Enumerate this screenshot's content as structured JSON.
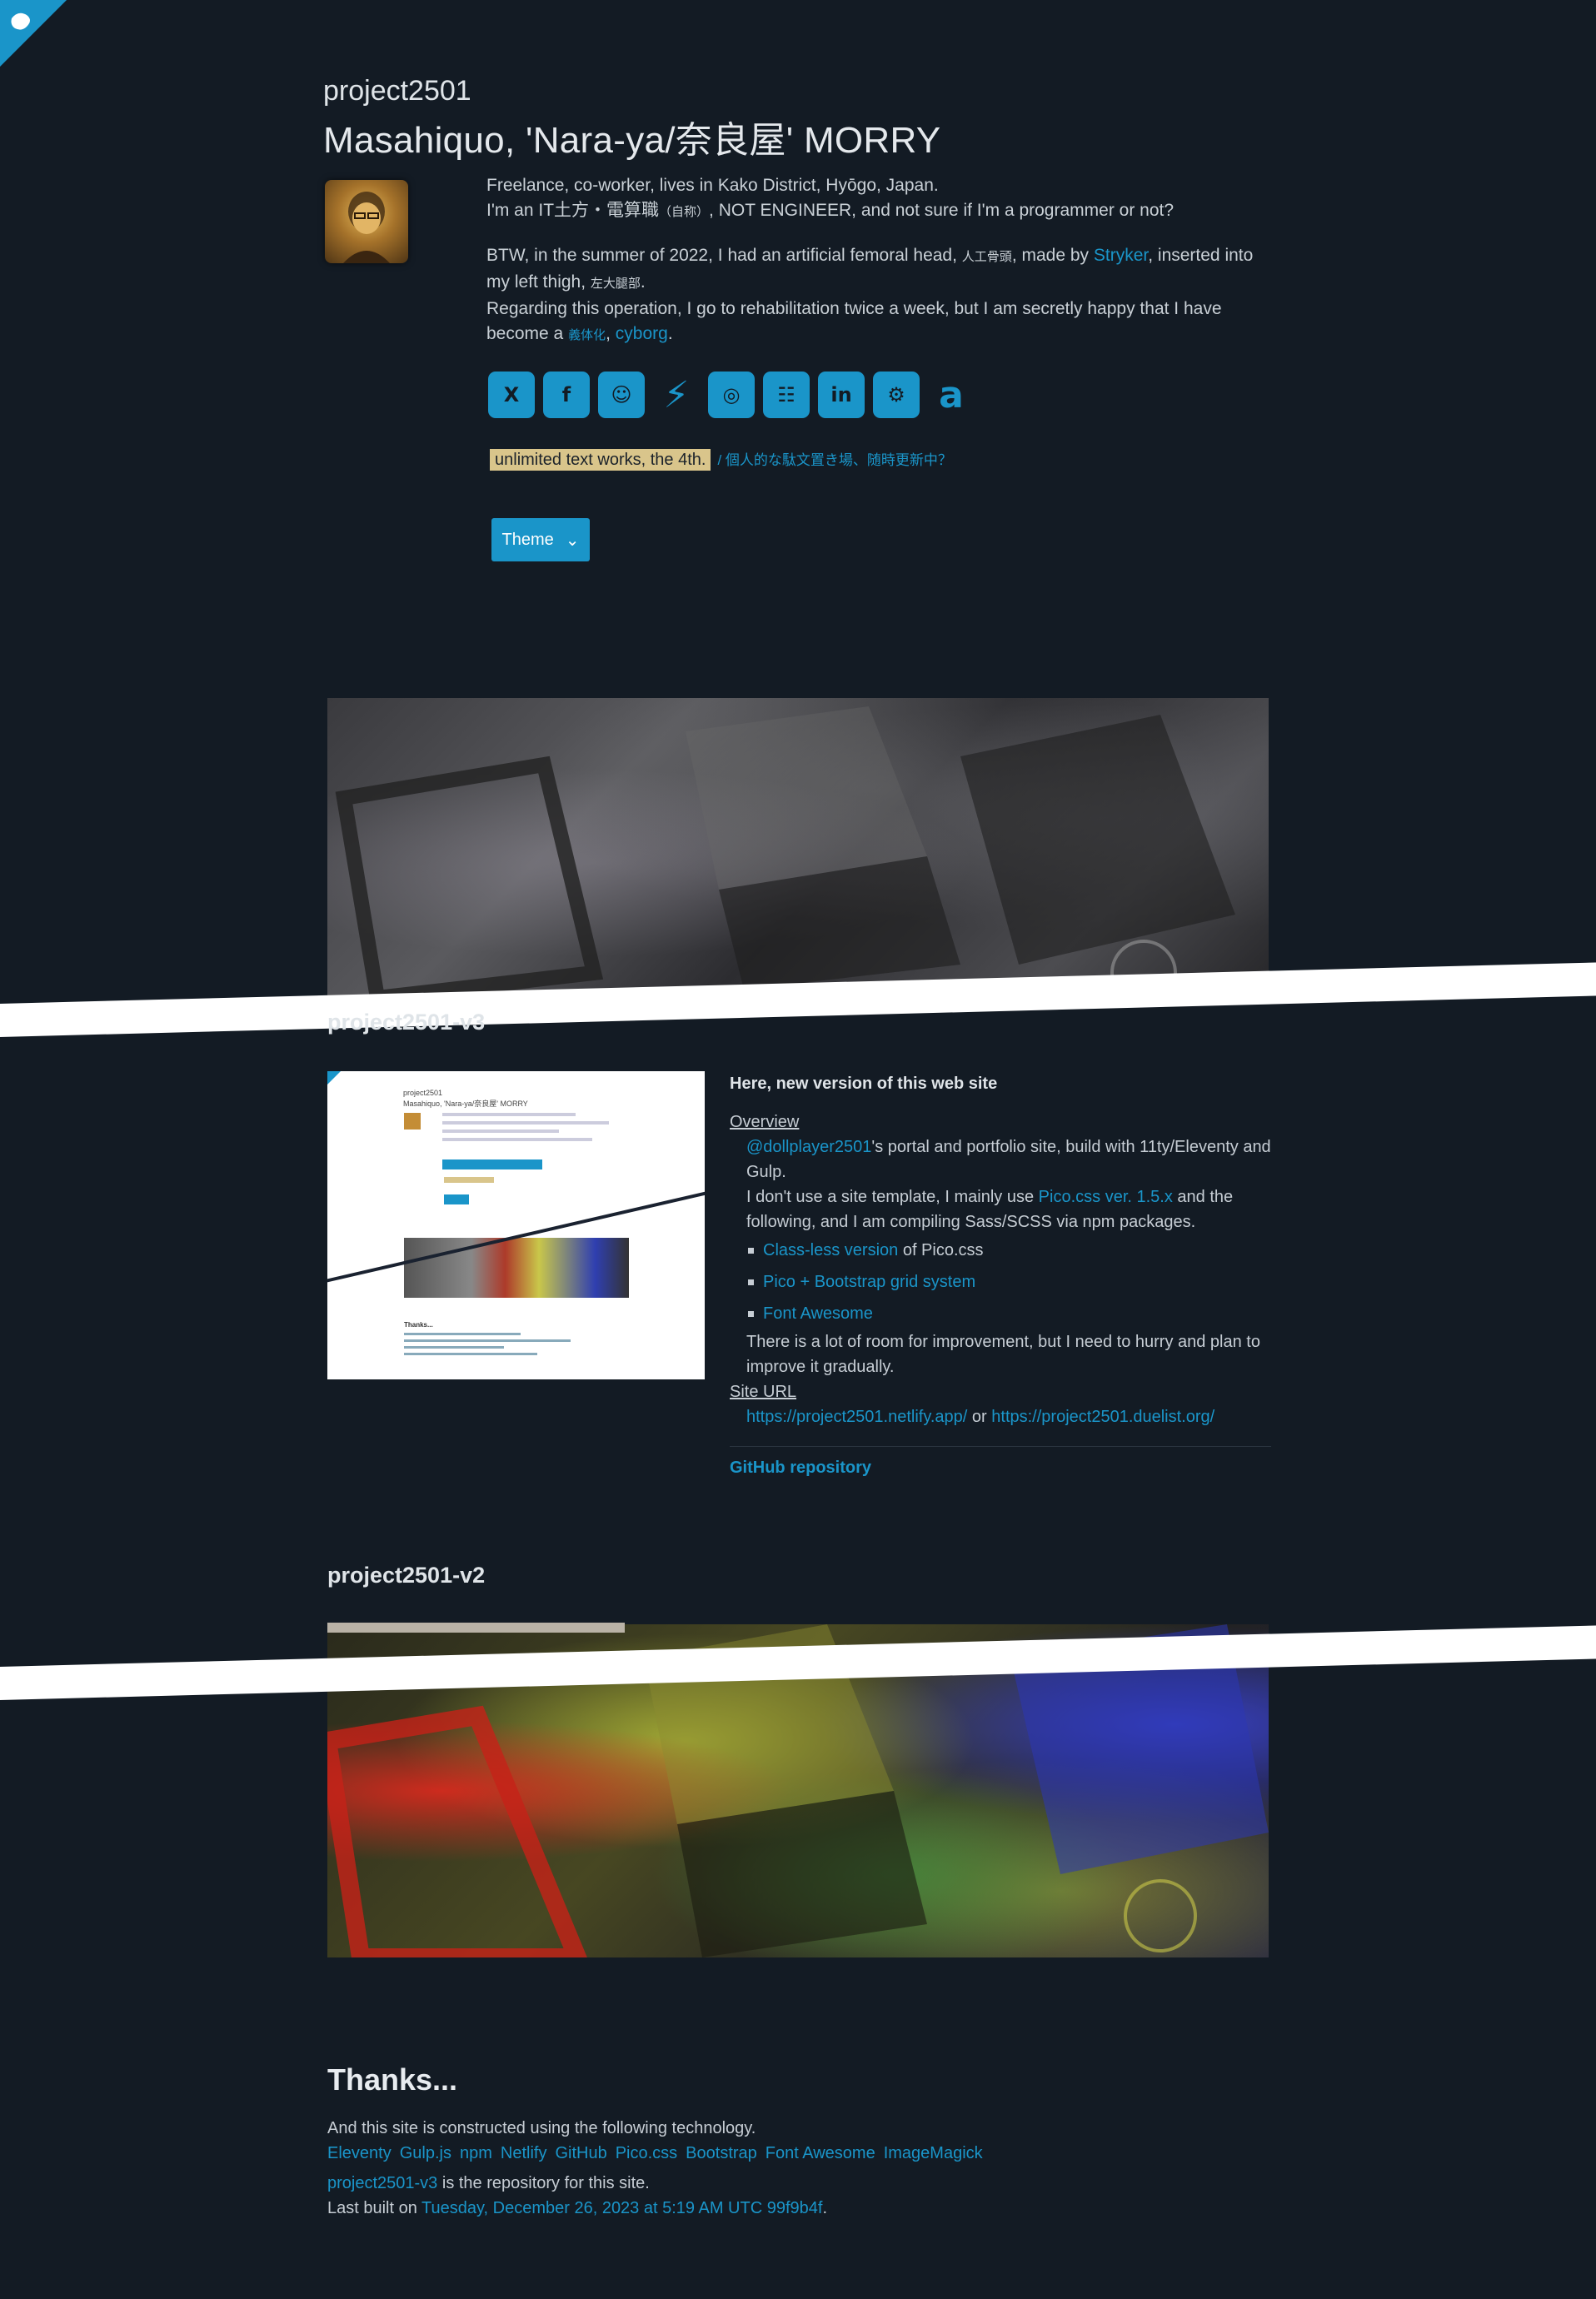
{
  "header": {
    "site_name": "project2501",
    "person_name": "Masahiquo, 'Nara-ya/奈良屋' MORRY"
  },
  "bio": {
    "line1": "Freelance, co-worker, lives in Kako District, Hyōgo, Japan.",
    "line2a": "I'm an IT土方・電算職",
    "line2_small": "（自称）",
    "line2b": ", NOT ENGINEER, and not sure if I'm a programmer or not?",
    "line3a": "BTW, in the summer of 2022, I had an artificial femoral head,",
    "line3_small": "人工骨頭",
    "line3b": ", made by",
    "stryker": "Stryker",
    "line3c": ", inserted into my left thigh,",
    "line3_small2": "左大腿部",
    "line3d": ".",
    "line4a": "Regarding this operation, I go to rehabilitation twice a week, but I am secretly happy that I have become a",
    "line4_small": "義体化",
    "line4b": ",",
    "cyborg": "cyborg",
    "line4c": "."
  },
  "socials": [
    {
      "icon": "x-icon",
      "glyph": "X"
    },
    {
      "icon": "facebook-icon",
      "glyph": "f"
    },
    {
      "icon": "github-icon",
      "glyph": "☺"
    },
    {
      "icon": "bolt-icon",
      "glyph": "⚡"
    },
    {
      "icon": "instagram-icon",
      "glyph": "◎"
    },
    {
      "icon": "slideshare-icon",
      "glyph": "☷"
    },
    {
      "icon": "linkedin-icon",
      "glyph": "in"
    },
    {
      "icon": "steam-icon",
      "glyph": "⚙"
    },
    {
      "icon": "amazon-icon",
      "glyph": "a"
    }
  ],
  "tagline": {
    "mark": "unlimited text works, the 4th.",
    "ja": "/ 個人的な駄文置き場、随時更新中？"
  },
  "theme_button": {
    "label": "Theme",
    "chevron": "⌄"
  },
  "v3": {
    "title": "project2501-v3",
    "screenshot": {
      "mini_title": "project2501",
      "mini_name": "Masahiquo, 'Nara-ya/奈良屋' MORRY",
      "mini_thanks": "Thanks..."
    },
    "heading": "Here, new version of this web site",
    "overview_label": "Overview",
    "overview_link": "@dollplayer2501",
    "overview_text1": "'s portal and portfolio site, build with 11ty/Eleventy and Gulp.",
    "overview_text2a": "I don't use a site template, I mainly use",
    "pico_link": "Pico.css ver. 1.5.x",
    "overview_text2b": "and the following, and I am compiling Sass/SCSS via npm packages.",
    "list": [
      {
        "link": "Class-less version",
        "rest": " of Pico.css"
      },
      {
        "link": "Pico + Bootstrap grid system",
        "rest": ""
      },
      {
        "link": "Font Awesome",
        "rest": ""
      }
    ],
    "improve_text": "There is a lot of room for improvement, but I need to hurry and plan to improve it gradually.",
    "site_url_label": "Site URL",
    "url1": "https://project2501.netlify.app/",
    "or": " or ",
    "url2": "https://project2501.duelist.org/",
    "github_link": "GitHub repository"
  },
  "v2": {
    "title": "project2501-v2"
  },
  "thanks": {
    "title": "Thanks...",
    "intro": "And this site is constructed using the following technology.",
    "tech": [
      "Eleventy",
      "Gulp.js",
      "npm",
      "Netlify",
      "GitHub",
      "Pico.css",
      "Bootstrap",
      "Font Awesome",
      "ImageMagick"
    ],
    "repo_link": "project2501-v3",
    "repo_text": " is the repository for this site.",
    "built_label": "Last built on ",
    "built_value": "Tuesday, December 26, 2023 at 5:19 AM UTC 99f9b4f",
    "built_end": "."
  },
  "colors": {
    "background": "#131b24",
    "accent": "#1a95c9",
    "mark": "#d9c58b"
  }
}
